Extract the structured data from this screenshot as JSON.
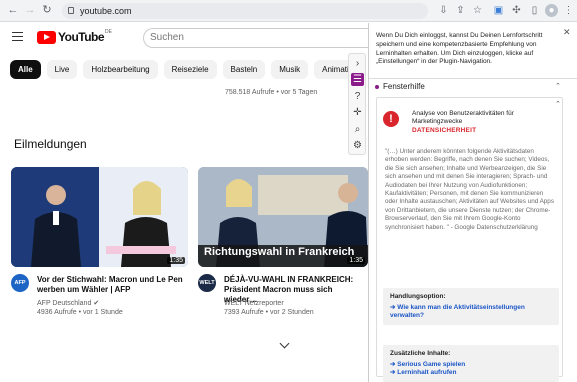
{
  "browser": {
    "url": "youtube.com"
  },
  "youtube": {
    "logo_text": "YouTube",
    "logo_country": "DE",
    "search_placeholder": "Suchen",
    "chips": [
      "Alle",
      "Live",
      "Holzbearbeitung",
      "Reiseziele",
      "Basteln",
      "Musik",
      "Animati"
    ],
    "views_top": "758.518 Aufrufe • vor 5 Tagen",
    "section_title": "Eilmeldungen",
    "videos": [
      {
        "title_line1": "Vor der Stichwahl: Macron und Le Pen",
        "title_line2": "werben um Wähler | AFP",
        "channel": "AFP Deutschland",
        "channel_avatar": "AFP",
        "meta": "4936 Aufrufe • vor 1 Stunde",
        "duration": "1:35"
      },
      {
        "title_line1": "DÉJÀ-VU-WAHL IN FRANKREICH:",
        "title_line2": "Präsident Macron muss sich wieder…",
        "channel": "WELT Netzreporter",
        "channel_avatar": "WELT",
        "meta": "7393 Aufrufe • vor 2 Stunden",
        "duration": "1:35",
        "thumb_caption": "Richtungswahl in Frankreich"
      }
    ]
  },
  "plugin": {
    "intro": "Wenn Du Dich einloggst, kannst Du Deinen Lernfortschritt speichern und eine kompetenzbasierte Empfehlung von Lerninhalten erhalten. Um Dich einzuloggen, klicke auf „Einstellungen“ in der Plugin-Navigation.",
    "section_label": "Fensterhilfe",
    "card_title": "Analyse von Benutzeraktivitäten für Marketingzwecke",
    "card_tag": "DATENSICHERHEIT",
    "card_quote": "\"(…) Unter anderem könnten folgende Aktivitätsdaten erhoben werden: Begriffe, nach denen Sie suchen; Videos, die Sie sich ansehen; Inhalte und Werbeanzeigen, die Sie sich ansehen und mit denen Sie interagieren; Sprach- und Audiodaten bei Ihrer Nutzung von Audiofunktionen; Kaufaktivitäten; Personen, mit denen Sie kommunizieren oder Inhalte austauschen; Aktivitäten auf Websites und Apps von Drittanbietern, die unsere Dienste nutzen; der Chrome-Browserverlauf, den Sie mit Ihrem Google-Konto synchronisiert haben. \" - Google Datenschutzerklärung",
    "action_head": "Handlungsoption:",
    "action_link": "➔ Wie kann man die Aktivitätseinstellungen verwalten?",
    "extra_head": "Zusätzliche Inhalte:",
    "extra_link1": "➔ Serious Game spielen",
    "extra_link2": "➔ Lerninhalt aufrufen"
  },
  "colors": {
    "accent": "#8b1a8b",
    "danger": "#d9262c",
    "link": "#1a55c6"
  }
}
